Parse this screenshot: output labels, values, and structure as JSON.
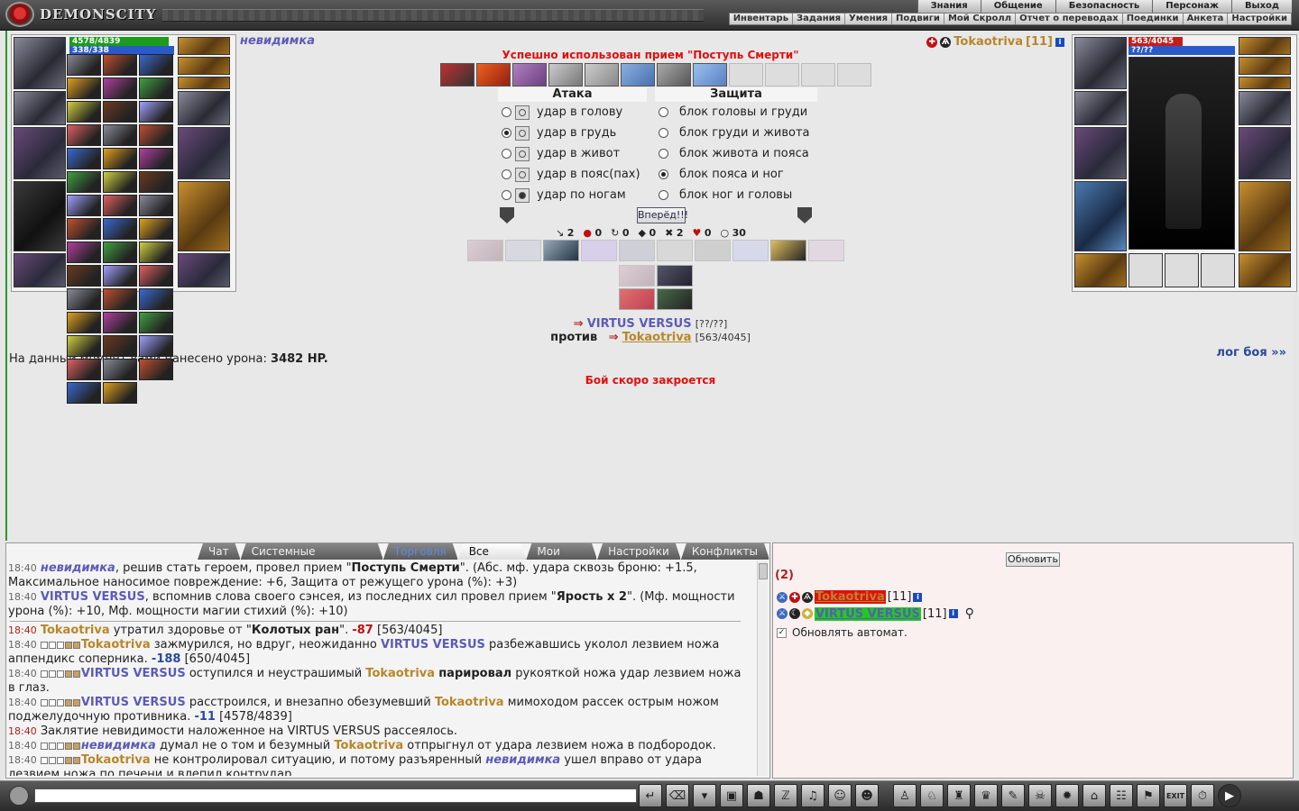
{
  "app": {
    "title": "DEMONSCITY"
  },
  "menu": {
    "main": [
      "Знания",
      "Общение",
      "Безопасность",
      "Персонаж",
      "Выход"
    ],
    "sub": [
      "Инвентарь",
      "Задания",
      "Умения",
      "Подвиги",
      "Мой Скролл",
      "Отчет о переводах",
      "Поединки",
      "Анкета",
      "Настройки"
    ]
  },
  "player": {
    "name": "невидимка",
    "hp": "4578/4839",
    "mp": "338/338",
    "hp_fraction": 0.946,
    "mp_fraction": 1.0
  },
  "enemy": {
    "name": "Tokaotriva",
    "level": "[11]",
    "hp": "563/4045",
    "mp": "??/??",
    "hp_fraction": 0.139
  },
  "battle": {
    "success_message": "Успешно использован прием \"Поступь Смерти\"",
    "attack_title": "Атака",
    "defense_title": "Защита",
    "attack_options": [
      "удар в голову",
      "удар в грудь",
      "удар в живот",
      "удар в пояс(пах)",
      "удар по ногам"
    ],
    "attack_selected": 1,
    "defense_options": [
      "блок головы и груди",
      "блок груди и живота",
      "блок живота и пояса",
      "блок пояса и ног",
      "блок ног и головы"
    ],
    "defense_selected": 3,
    "forward_button": "Вперёд!!!",
    "stats": [
      "2",
      "0",
      "0",
      "0",
      "2",
      "0",
      "30"
    ],
    "fighter_a": "VIRTUS VERSUS",
    "fighter_a_hp": "[??/??]",
    "versus_label": "против",
    "fighter_b": "Tokaotriva",
    "fighter_b_hp": "[563/4045]",
    "damage_prefix": "На данный момент вами нанесено урона:",
    "damage_value": "3482 HP.",
    "log_link": "лог боя »»",
    "closing_message": "Бой скоро закроется"
  },
  "chat": {
    "tabs": [
      "Чат",
      "Системные сообщения",
      "Торговля",
      "Все логи",
      "Мои логи",
      "Настройки",
      "Конфликты"
    ],
    "active_tab": "Все логи",
    "log": [
      {
        "time": "18:40",
        "parts": [
          [
            "nm-inv",
            "невидимка"
          ],
          [
            "",
            ", решив стать героем, провел прием \""
          ],
          [
            "b",
            "Поступь Смерти"
          ],
          [
            "",
            "\". (Абс. мф. удара сквозь броню: +1.5, Максимальное наносимое повреждение: +6, Защита от режущего урона (%): +3)"
          ]
        ]
      },
      {
        "time": "18:40",
        "parts": [
          [
            "nm-vv",
            "VIRTUS VERSUS"
          ],
          [
            "",
            ", вспомнив слова своего сэнсея, из последних сил провел прием \""
          ],
          [
            "b",
            "Ярость х 2"
          ],
          [
            "",
            "\". (Мф. мощности урона (%): +10, Мф. мощности магии стихий (%): +10)"
          ]
        ]
      },
      {
        "time": "18:40",
        "red": true,
        "parts": [
          [
            "nm-tk",
            "Tokaotriva"
          ],
          [
            "",
            " утратил здоровье от \""
          ],
          [
            "b",
            "Колотых ран"
          ],
          [
            "",
            "\". "
          ],
          [
            "num-red",
            "-87"
          ],
          [
            "",
            " [563/4045]"
          ]
        ]
      },
      {
        "time": "18:40",
        "sq": true,
        "parts": [
          [
            "nm-tk",
            "Tokaotriva"
          ],
          [
            "",
            " зажмурился, но вдруг, неожиданно "
          ],
          [
            "nm-vv",
            "VIRTUS VERSUS"
          ],
          [
            "",
            " разбежавшись уколол лезвием ножа аппендикс соперника. "
          ],
          [
            "num-blue",
            "-188"
          ],
          [
            "",
            " [650/4045]"
          ]
        ]
      },
      {
        "time": "18:40",
        "sq": true,
        "parts": [
          [
            "nm-vv",
            "VIRTUS VERSUS"
          ],
          [
            "",
            " оступился и неустрашимый "
          ],
          [
            "nm-tk",
            "Tokaotriva"
          ],
          [
            "",
            " "
          ],
          [
            "b",
            "парировал"
          ],
          [
            "",
            " рукояткой ножа удар лезвием ножа в глаз."
          ]
        ]
      },
      {
        "time": "18:40",
        "sq": true,
        "parts": [
          [
            "nm-vv",
            "VIRTUS VERSUS"
          ],
          [
            "",
            " расстроился, и внезапно обезумевший "
          ],
          [
            "nm-tk",
            "Tokaotriva"
          ],
          [
            "",
            " мимоходом рассек острым ножом поджелудочную противника. "
          ],
          [
            "num-blue",
            "-11"
          ],
          [
            "",
            " [4578/4839]"
          ]
        ]
      },
      {
        "time": "18:40",
        "red": true,
        "parts": [
          [
            "",
            "Заклятие невидимости наложенное на VIRTUS VERSUS рассеялось."
          ]
        ]
      },
      {
        "time": "18:40",
        "sq": true,
        "parts": [
          [
            "nm-inv",
            "невидимка"
          ],
          [
            "",
            " думал не о том и безумный "
          ],
          [
            "nm-tk",
            "Tokaotriva"
          ],
          [
            "",
            " отпрыгнул от удара лезвием ножа в подбородок."
          ]
        ]
      },
      {
        "time": "18:40",
        "sq": true,
        "parts": [
          [
            "nm-tk",
            "Tokaotriva"
          ],
          [
            "",
            " не контролировал ситуацию, и потому разъяренный "
          ],
          [
            "nm-inv",
            "невидимка"
          ],
          [
            "",
            " ушел вправо от удара лезвием ножа по печени и влепил контрудар."
          ]
        ]
      }
    ]
  },
  "rpanel": {
    "refresh_button": "Обновить",
    "count": "(2)",
    "players": [
      {
        "name": "Tokaotriva",
        "level": "[11]",
        "team": "red"
      },
      {
        "name": "VIRTUS VERSUS",
        "level": "[11]",
        "team": "green"
      }
    ],
    "auto_refresh_label": "Обновлять автомат."
  },
  "toolbar": {
    "input_value": "",
    "exit_label": "EXIT"
  }
}
